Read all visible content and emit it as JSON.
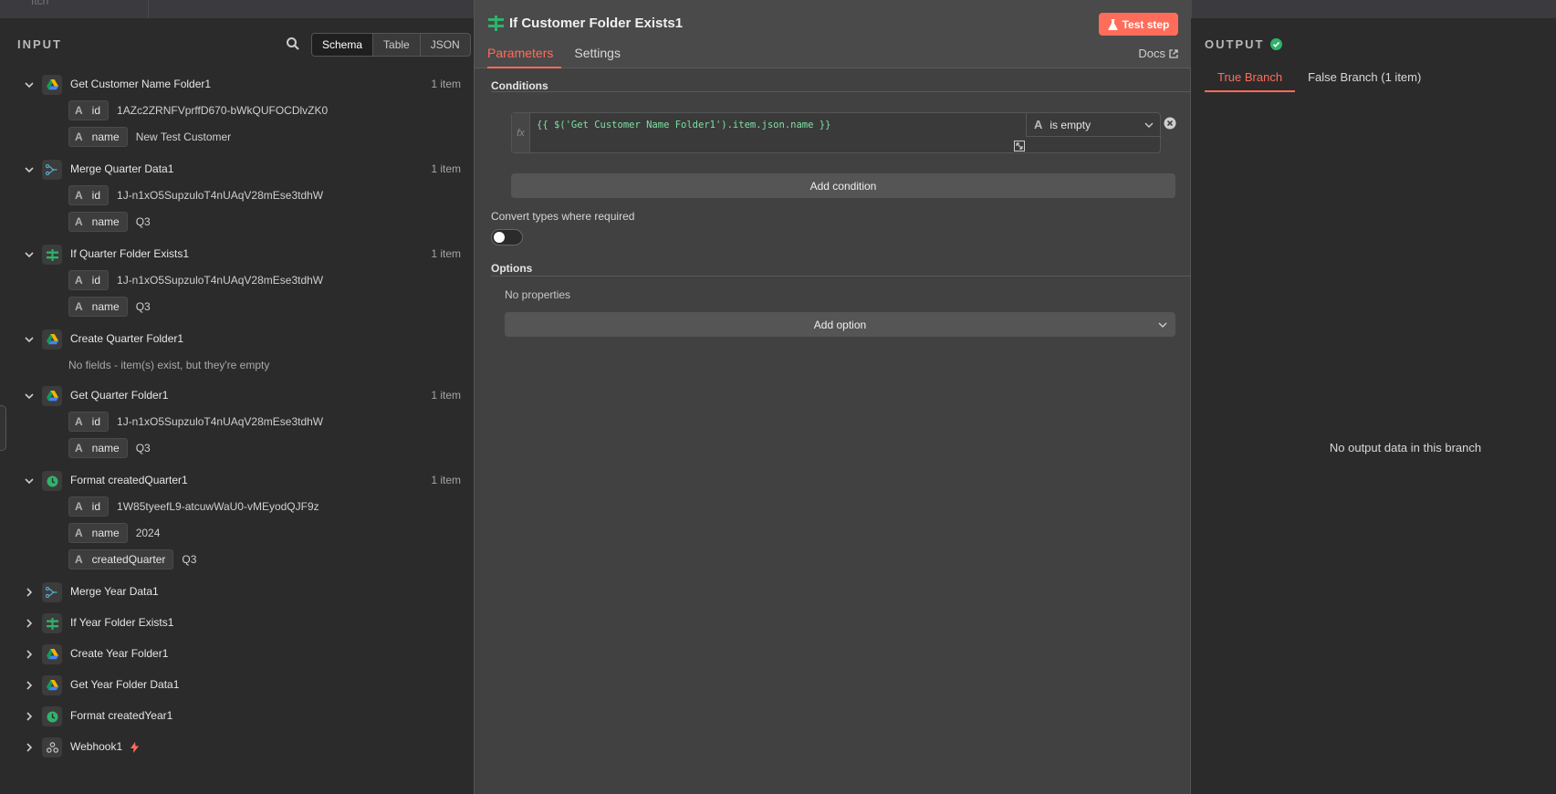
{
  "topbar": {
    "ghost_text": "Itch"
  },
  "input": {
    "title": "INPUT",
    "view_modes": [
      "Schema",
      "Table",
      "JSON"
    ],
    "nodes": [
      {
        "name": "Get Customer Name Folder1",
        "icon": "google-drive-icon",
        "count": "1 item",
        "expanded": true,
        "fields": [
          {
            "type": "A",
            "name": "id",
            "value": "1AZc2ZRNFVprffD670-bWkQUFOCDlvZK0"
          },
          {
            "type": "A",
            "name": "name",
            "value": "New Test Customer"
          }
        ]
      },
      {
        "name": "Merge Quarter Data1",
        "icon": "merge-icon",
        "count": "1 item",
        "expanded": true,
        "fields": [
          {
            "type": "A",
            "name": "id",
            "value": "1J-n1xO5SupzuloT4nUAqV28mEse3tdhW"
          },
          {
            "type": "A",
            "name": "name",
            "value": "Q3"
          }
        ]
      },
      {
        "name": "If Quarter Folder Exists1",
        "icon": "if-icon",
        "count": "1 item",
        "expanded": true,
        "fields": [
          {
            "type": "A",
            "name": "id",
            "value": "1J-n1xO5SupzuloT4nUAqV28mEse3tdhW"
          },
          {
            "type": "A",
            "name": "name",
            "value": "Q3"
          }
        ]
      },
      {
        "name": "Create Quarter Folder1",
        "icon": "google-drive-icon",
        "count": "",
        "expanded": true,
        "note": "No fields - item(s) exist, but they're empty",
        "fields": []
      },
      {
        "name": "Get Quarter Folder1",
        "icon": "google-drive-icon",
        "count": "1 item",
        "expanded": true,
        "fields": [
          {
            "type": "A",
            "name": "id",
            "value": "1J-n1xO5SupzuloT4nUAqV28mEse3tdhW"
          },
          {
            "type": "A",
            "name": "name",
            "value": "Q3"
          }
        ]
      },
      {
        "name": "Format createdQuarter1",
        "icon": "clock-icon",
        "count": "1 item",
        "expanded": true,
        "fields": [
          {
            "type": "A",
            "name": "id",
            "value": "1W85tyeefL9-atcuwWaU0-vMEyodQJF9z"
          },
          {
            "type": "A",
            "name": "name",
            "value": "2024"
          },
          {
            "type": "A",
            "name": "createdQuarter",
            "value": "Q3"
          }
        ]
      },
      {
        "name": "Merge Year Data1",
        "icon": "merge-icon",
        "count": "",
        "expanded": false,
        "fields": []
      },
      {
        "name": "If Year Folder Exists1",
        "icon": "if-icon",
        "count": "",
        "expanded": false,
        "fields": []
      },
      {
        "name": "Create Year Folder1",
        "icon": "google-drive-icon",
        "count": "",
        "expanded": false,
        "fields": []
      },
      {
        "name": "Get Year Folder Data1",
        "icon": "google-drive-icon",
        "count": "",
        "expanded": false,
        "fields": []
      },
      {
        "name": "Format createdYear1",
        "icon": "clock-icon",
        "count": "",
        "expanded": false,
        "fields": []
      },
      {
        "name": "Webhook1",
        "icon": "webhook-icon",
        "count": "",
        "expanded": false,
        "fields": [],
        "trigger": true
      }
    ]
  },
  "params": {
    "node_title": "If Customer Folder Exists1",
    "test_button": "Test step",
    "tabs": [
      "Parameters",
      "Settings"
    ],
    "docs_link": "Docs",
    "conditions_label": "Conditions",
    "condition_expression": "{{ $('Get Customer Name Folder1').item.json.name }}",
    "fx_label": "fx",
    "operator_type": "A",
    "operator_value": "is empty",
    "add_condition": "Add condition",
    "convert_types_label": "Convert types where required",
    "options_label": "Options",
    "no_properties": "No properties",
    "add_option": "Add option"
  },
  "output": {
    "title": "OUTPUT",
    "tabs": [
      "True Branch",
      "False Branch (1 item)"
    ],
    "empty_message": "No output data in this branch"
  },
  "colors": {
    "accent": "#ff6d5a",
    "success": "#2fb36a",
    "expression": "#7ee0a2"
  }
}
